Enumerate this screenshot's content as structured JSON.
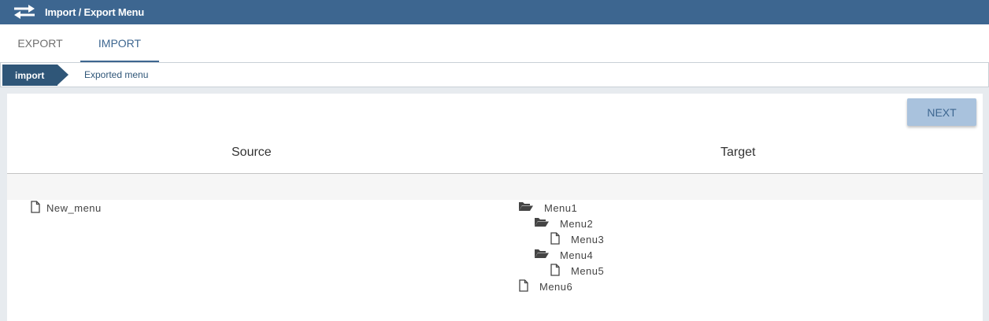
{
  "window": {
    "title": "Import / Export Menu",
    "icon": "swap-arrows-icon",
    "accent": "#3d6690"
  },
  "tabs": [
    {
      "label": "EXPORT",
      "active": false
    },
    {
      "label": "IMPORT",
      "active": true
    }
  ],
  "breadcrumb": {
    "active": "import",
    "next": "Exported menu"
  },
  "actions": {
    "next_label": "NEXT"
  },
  "columns": {
    "source": "Source",
    "target": "Target"
  },
  "source_tree": [
    {
      "label": "New_menu",
      "type": "file",
      "depth": 0
    }
  ],
  "target_tree": [
    {
      "label": "Menu1",
      "type": "folder-open",
      "depth": 0
    },
    {
      "label": "Menu2",
      "type": "folder-open",
      "depth": 1
    },
    {
      "label": "Menu3",
      "type": "file",
      "depth": 2
    },
    {
      "label": "Menu4",
      "type": "folder-open",
      "depth": 1
    },
    {
      "label": "Menu5",
      "type": "file",
      "depth": 2
    },
    {
      "label": "Menu6",
      "type": "file",
      "depth": 0
    }
  ]
}
